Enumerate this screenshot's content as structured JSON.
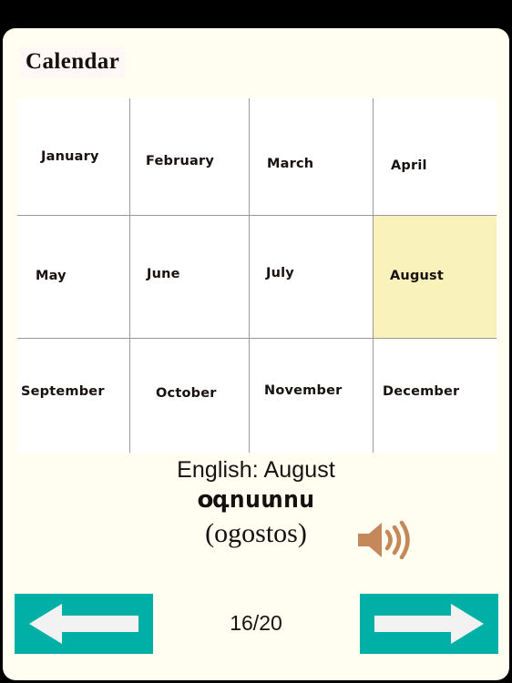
{
  "window": {
    "status_bar_color": "#000000",
    "card_background": "#FFFEF0"
  },
  "header": {
    "title": "Calendar"
  },
  "calendar": {
    "columns": 4,
    "rows": 3,
    "selected_month": "August",
    "selected_highlight_color": "#FAF2BB",
    "months": [
      {
        "label": "January",
        "selected": false
      },
      {
        "label": "February",
        "selected": false
      },
      {
        "label": "March",
        "selected": false
      },
      {
        "label": "April",
        "selected": false
      },
      {
        "label": "May",
        "selected": false
      },
      {
        "label": "June",
        "selected": false
      },
      {
        "label": "July",
        "selected": false
      },
      {
        "label": "August",
        "selected": true
      },
      {
        "label": "September",
        "selected": false
      },
      {
        "label": "October",
        "selected": false
      },
      {
        "label": "November",
        "selected": false
      },
      {
        "label": "December",
        "selected": false
      }
    ]
  },
  "translation": {
    "english_line": "English: August",
    "native_word": "օգոստոս",
    "romanization": "(ogostos)",
    "audio_icon": "speaker-icon",
    "audio_icon_color": "#C4885B"
  },
  "navigation": {
    "previous_icon": "arrow-left-icon",
    "next_icon": "arrow-right-icon",
    "button_color": "#00B0A6",
    "arrow_color": "#F2F2F2",
    "page_counter": "16/20",
    "current_page": 16,
    "total_pages": 20
  }
}
